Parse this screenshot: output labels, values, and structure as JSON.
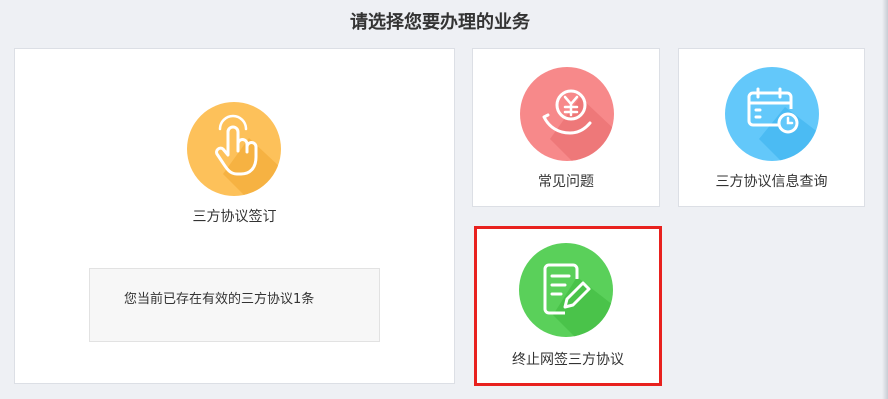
{
  "header": {
    "title": "请选择您要办理的业务"
  },
  "cards": {
    "sign": {
      "label": "三方协议签订",
      "icon": "hand-pointer-icon",
      "color": "#fdc15a"
    },
    "faq": {
      "label": "常见问题",
      "icon": "yuan-coin-hand-icon",
      "color": "#f7898a"
    },
    "query": {
      "label": "三方协议信息查询",
      "icon": "calendar-clock-icon",
      "color": "#63c8fa"
    },
    "terminate": {
      "label": "终止网签三方协议",
      "icon": "document-edit-icon",
      "color": "#5ad05a"
    }
  },
  "notice": {
    "text": "您当前已存在有效的三方协议1条"
  },
  "colors": {
    "highlight_border": "#e8211e",
    "background": "#eef0f4"
  }
}
